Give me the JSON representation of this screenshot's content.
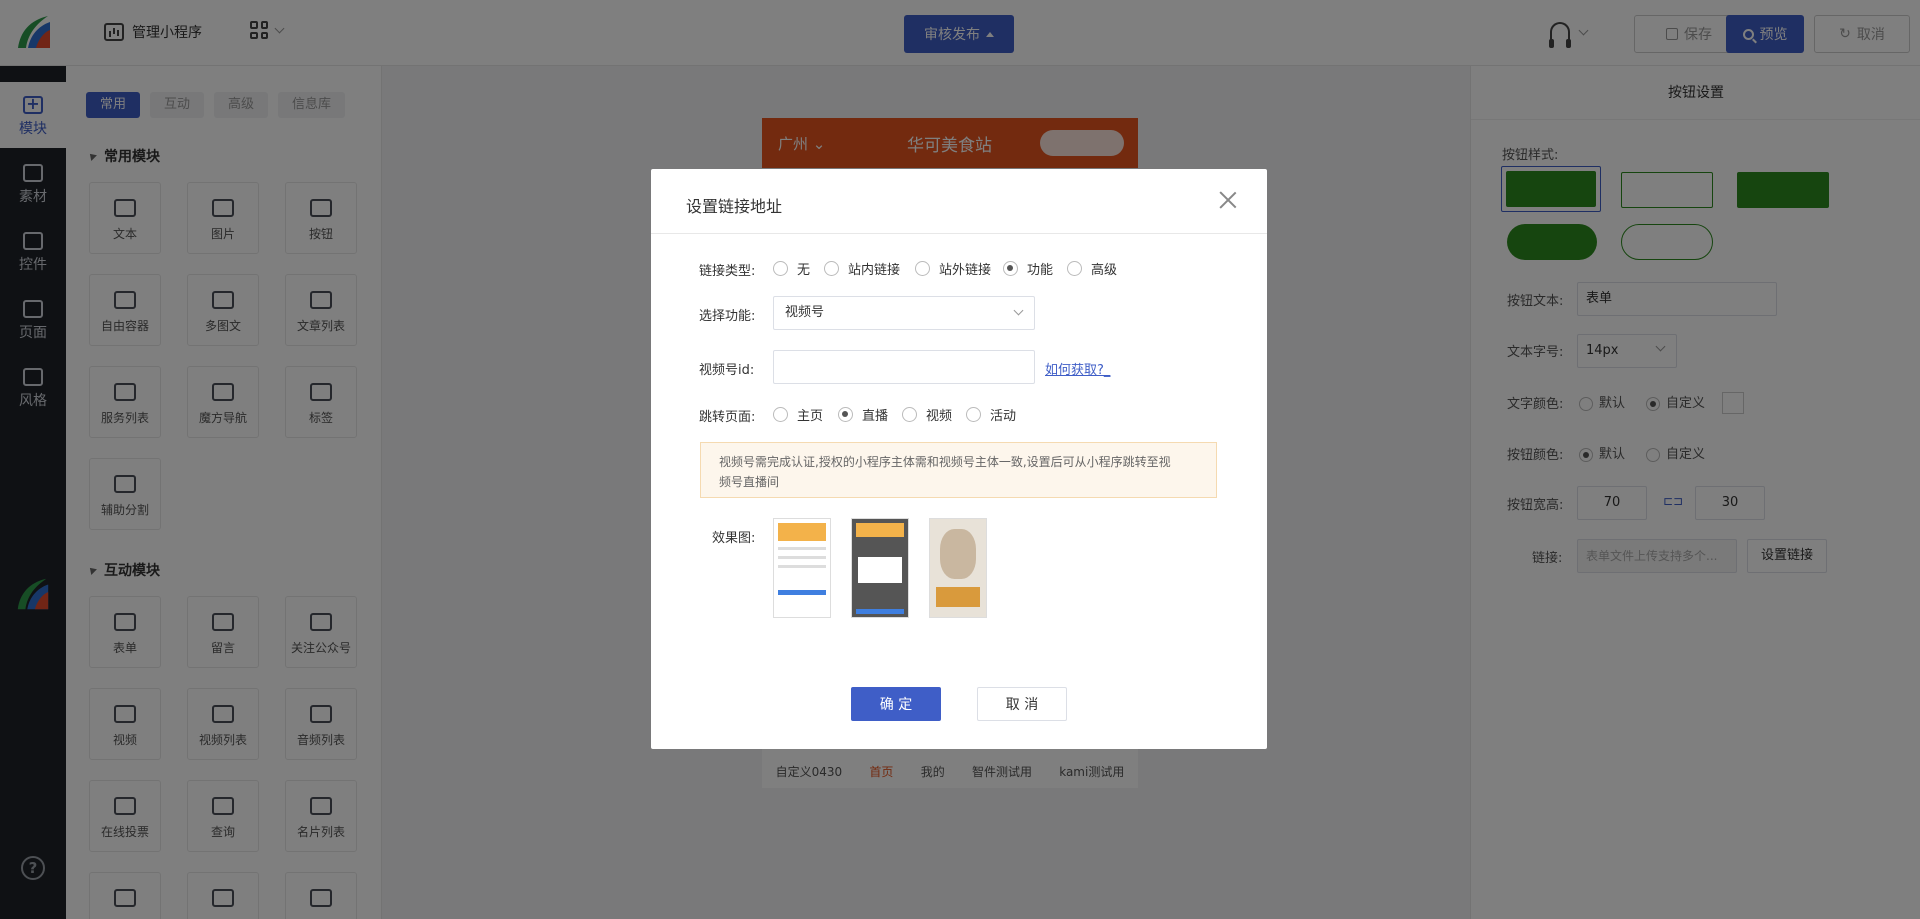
{
  "header": {
    "manage_label": "管理小程序",
    "publish_label": "审核发布",
    "save_label": "保存",
    "preview_label": "预览",
    "cancel_label": "取消"
  },
  "sidebar": {
    "items": [
      {
        "label": "模块"
      },
      {
        "label": "素材"
      },
      {
        "label": "控件"
      },
      {
        "label": "页面"
      },
      {
        "label": "风格"
      }
    ],
    "help": "?"
  },
  "modules": {
    "tabs": [
      "常用",
      "互动",
      "高级",
      "信息库"
    ],
    "common_title": "常用模块",
    "common": [
      "文本",
      "图片",
      "按钮",
      "自由容器",
      "多图文",
      "文章列表",
      "服务列表",
      "魔方导航",
      "标签",
      "辅助分割"
    ],
    "interactive_title": "互动模块",
    "interactive": [
      "表单",
      "留言",
      "关注公众号",
      "视频",
      "视频列表",
      "音频列表",
      "在线投票",
      "查询",
      "名片列表"
    ]
  },
  "phone": {
    "city": "广州",
    "title": "华可美食站",
    "tabbar": [
      "自定义0430",
      "首页",
      "我的",
      "智件测试用",
      "kami测试用"
    ]
  },
  "right_panel": {
    "title": "按钮设置",
    "style_label": "按钮样式:",
    "text_label": "按钮文本:",
    "text_value": "表单",
    "size_label": "文本字号:",
    "size_value": "14px",
    "text_color_label": "文字颜色:",
    "text_color_options": [
      "默认",
      "自定义"
    ],
    "btn_color_label": "按钮颜色:",
    "btn_color_options": [
      "默认",
      "自定义"
    ],
    "wh_label": "按钮宽高:",
    "width": "70",
    "height": "30",
    "link_label": "链接:",
    "link_placeholder": "表单文件上传支持多个...",
    "set_link": "设置链接"
  },
  "modal": {
    "title": "设置链接地址",
    "link_type_label": "链接类型:",
    "link_types": [
      "无",
      "站内链接",
      "站外链接",
      "功能",
      "高级"
    ],
    "func_label": "选择功能:",
    "func_value": "视频号",
    "vid_label": "视频号id:",
    "how_link": "如何获取?_",
    "jump_label": "跳转页面:",
    "jump_options": [
      "主页",
      "直播",
      "视频",
      "活动"
    ],
    "notice_line1": "视频号需完成认证,授权的小程序主体需和视频号主体一致,设置后可从小程序跳转至视",
    "notice_line2": "频号直播间",
    "effect_label": "效果图:",
    "ok": "确 定",
    "cancel": "取 消"
  },
  "colors": {
    "accent": "#3f5ec7",
    "brand_green": "#2d8a1e",
    "phone_header": "#e6541f"
  }
}
